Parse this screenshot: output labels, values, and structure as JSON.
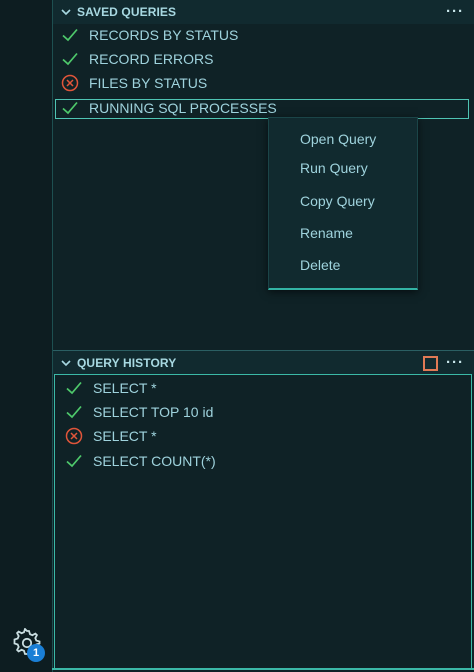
{
  "saved_queries": {
    "title": "SAVED QUERIES",
    "more": "···",
    "items": [
      {
        "label": "RECORDS BY STATUS",
        "status": "success"
      },
      {
        "label": "RECORD ERRORS",
        "status": "success"
      },
      {
        "label": "FILES BY STATUS",
        "status": "error"
      },
      {
        "label": "RUNNING SQL PROCESSES",
        "status": "success"
      }
    ]
  },
  "context_menu": {
    "items": [
      "Open Query",
      "Run Query",
      "Copy Query",
      "Rename",
      "Delete"
    ]
  },
  "query_history": {
    "title": "QUERY HISTORY",
    "more": "···",
    "items": [
      {
        "label": "SELECT *",
        "status": "success"
      },
      {
        "label": "SELECT TOP 10 id",
        "status": "success"
      },
      {
        "label": "SELECT *",
        "status": "error"
      },
      {
        "label": "SELECT COUNT(*)",
        "status": "success"
      }
    ]
  },
  "activity_bar": {
    "settings_badge": "1"
  },
  "colors": {
    "success": "#4ec96b",
    "error": "#e0553a",
    "accent": "#3bb9a7"
  }
}
